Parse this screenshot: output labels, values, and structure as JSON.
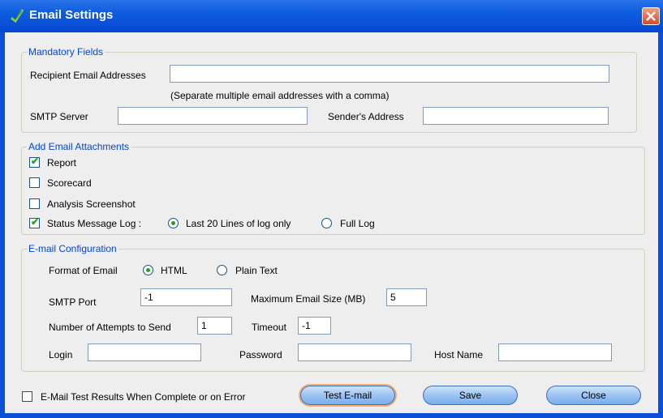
{
  "window": {
    "title": "Email Settings"
  },
  "mandatory": {
    "legend": "Mandatory Fields",
    "recipient_label": "Recipient Email Addresses",
    "recipient_value": "",
    "recipient_hint": "(Separate multiple email addresses with a comma)",
    "smtp_server_label": "SMTP Server",
    "smtp_server_value": "",
    "sender_label": "Sender's Address",
    "sender_value": ""
  },
  "attachments": {
    "legend": "Add Email Attachments",
    "report": {
      "label": "Report",
      "checked": true
    },
    "scorecard": {
      "label": "Scorecard",
      "checked": false
    },
    "analysis": {
      "label": "Analysis Screenshot",
      "checked": false
    },
    "status_log": {
      "label": "Status Message Log :",
      "checked": true
    },
    "log_last20": {
      "label": "Last 20 Lines of log only",
      "selected": true
    },
    "log_full": {
      "label": "Full Log",
      "selected": false
    }
  },
  "config": {
    "legend": "E-mail Configuration",
    "format_label": "Format of Email",
    "format_html": {
      "label": "HTML",
      "selected": true
    },
    "format_plain": {
      "label": "Plain Text",
      "selected": false
    },
    "smtp_port_label": "SMTP Port",
    "smtp_port_value": "-1",
    "max_size_label": "Maximum Email Size (MB)",
    "max_size_value": "5",
    "attempts_label": "Number of Attempts to Send",
    "attempts_value": "1",
    "timeout_label": "Timeout",
    "timeout_value": "-1",
    "login_label": "Login",
    "login_value": "",
    "password_label": "Password",
    "password_value": "",
    "host_label": "Host Name",
    "host_value": ""
  },
  "footer": {
    "email_results": {
      "label": "E-Mail Test Results When Complete or on Error",
      "checked": false
    },
    "test_label": "Test E-mail",
    "save_label": "Save",
    "close_label": "Close"
  },
  "colors": {
    "title_bar": "#0a4fd6",
    "group_text": "#0046d5",
    "check_mark": "#21a121"
  }
}
